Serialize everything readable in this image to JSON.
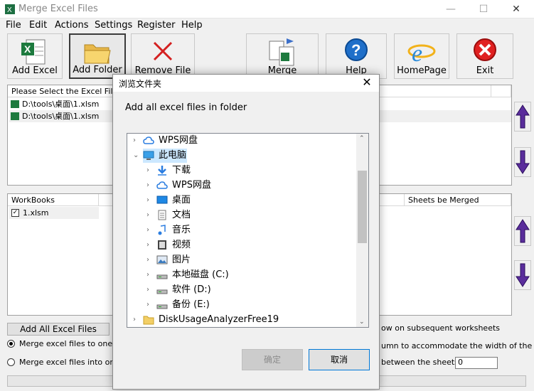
{
  "window": {
    "title": "Merge Excel Files",
    "minimize": "—",
    "maximize": "☐",
    "close": "✕"
  },
  "menu": [
    "File",
    "Edit",
    "Actions",
    "Settings",
    "Register",
    "Help"
  ],
  "toolbar": {
    "add_excel": "Add Excel",
    "add_folder": "Add Folder",
    "remove_file": "Remove File",
    "merge": "Merge",
    "help": "Help",
    "homepage": "HomePage",
    "exit": "Exit"
  },
  "files_list": {
    "header": "Please Select the Excel File or",
    "rows": [
      "D:\\tools\\桌面\\1.xlsm",
      "D:\\tools\\桌面\\1.xlsm"
    ]
  },
  "workbooks": {
    "header_workbooks": "WorkBooks",
    "header_sheets": "Sheets be Merged",
    "rows": [
      {
        "name": "1.xlsm",
        "checked": true
      }
    ]
  },
  "options": {
    "add_all_button": "Add All Excel Files",
    "merge_one_new": "Merge excel files to one nev",
    "merge_into_one": "Merge excel files into one ne",
    "right_text_1": "ow on subsequent worksheets",
    "right_text_2": "umn to accommodate the width of the text",
    "right_text_3": "between the sheets:",
    "spacing_value": "0"
  },
  "dialog": {
    "title": "浏览文件夹",
    "description": "Add all excel files in folder",
    "tree": [
      {
        "label": "WPS网盘",
        "icon": "cloud-icon",
        "indent": 0,
        "chevron": "›"
      },
      {
        "label": "此电脑",
        "icon": "computer-icon",
        "indent": 0,
        "chevron": "⌄",
        "selected": true
      },
      {
        "label": "下载",
        "icon": "download-icon",
        "indent": 1,
        "chevron": "›"
      },
      {
        "label": "WPS网盘",
        "icon": "cloud-icon",
        "indent": 1,
        "chevron": "›"
      },
      {
        "label": "桌面",
        "icon": "desktop-icon",
        "indent": 1,
        "chevron": "›"
      },
      {
        "label": "文档",
        "icon": "document-icon",
        "indent": 1,
        "chevron": "›"
      },
      {
        "label": "音乐",
        "icon": "music-icon",
        "indent": 1,
        "chevron": "›"
      },
      {
        "label": "视频",
        "icon": "video-icon",
        "indent": 1,
        "chevron": "›"
      },
      {
        "label": "图片",
        "icon": "picture-icon",
        "indent": 1,
        "chevron": "›"
      },
      {
        "label": "本地磁盘 (C:)",
        "icon": "drive-icon",
        "indent": 1,
        "chevron": "›"
      },
      {
        "label": "软件 (D:)",
        "icon": "drive-icon",
        "indent": 1,
        "chevron": "›"
      },
      {
        "label": "备份 (E:)",
        "icon": "drive-icon",
        "indent": 1,
        "chevron": "›"
      },
      {
        "label": "DiskUsageAnalyzerFree19",
        "icon": "folder-icon",
        "indent": 0,
        "chevron": "›"
      }
    ],
    "ok": "确定",
    "cancel": "取消"
  }
}
